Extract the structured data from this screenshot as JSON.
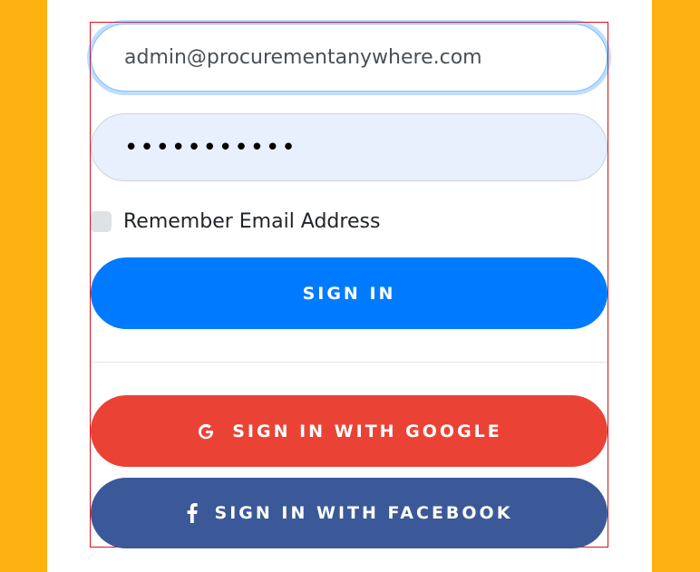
{
  "colors": {
    "background": "#FDB211",
    "panel": "#ffffff",
    "primary": "#007bff",
    "google": "#ea4335",
    "facebook": "#3b5998",
    "highlight_frame": "#d9121f"
  },
  "login_form": {
    "email": {
      "value": "admin@procurementanywhere.com",
      "focused": true
    },
    "password": {
      "masked_value": "•••••••••••"
    },
    "remember": {
      "label": "Remember Email Address",
      "checked": false
    },
    "sign_in_button": {
      "label": "SIGN IN"
    },
    "google_button": {
      "label": "SIGN IN WITH GOOGLE",
      "icon": "google-icon"
    },
    "facebook_button": {
      "label": "SIGN IN WITH FACEBOOK",
      "icon": "facebook-icon"
    }
  }
}
